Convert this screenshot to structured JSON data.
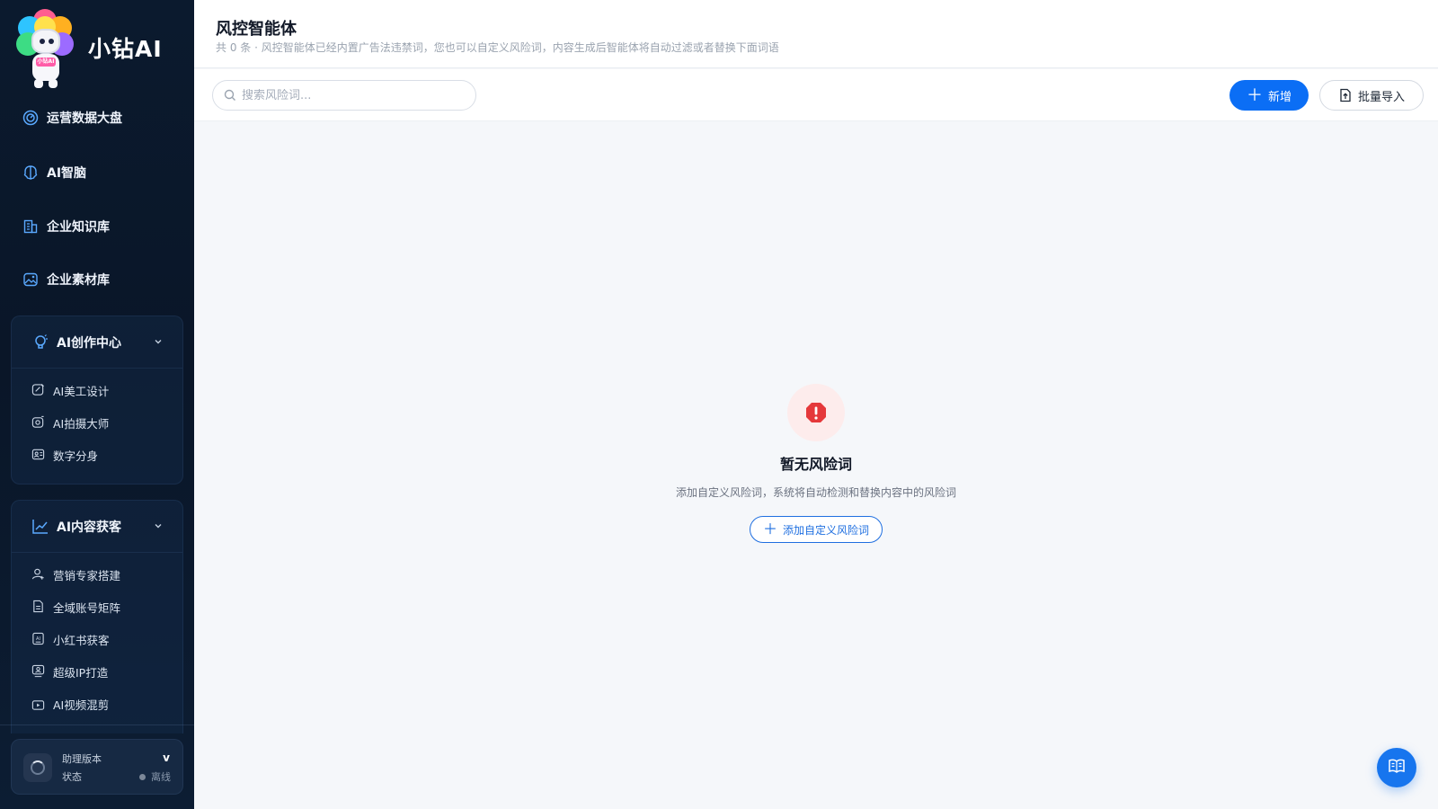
{
  "brand": {
    "name": "小钻AI",
    "mascot_badge": "小钻AI"
  },
  "sidebar": {
    "nav": [
      {
        "label": "运营数据大盘",
        "icon": "dashboard-icon"
      },
      {
        "label": "AI智脑",
        "icon": "brain-icon"
      },
      {
        "label": "企业知识库",
        "icon": "building-icon"
      },
      {
        "label": "企业素材库",
        "icon": "image-icon"
      }
    ],
    "groups": [
      {
        "label": "AI创作中心",
        "icon": "bulb-icon",
        "items": [
          {
            "label": "AI美工设计",
            "icon": "palette-icon"
          },
          {
            "label": "AI拍摄大师",
            "icon": "camera-icon"
          },
          {
            "label": "数字分身",
            "icon": "avatar-card-icon"
          }
        ]
      },
      {
        "label": "AI内容获客",
        "icon": "chart-line-icon",
        "items": [
          {
            "label": "营销专家搭建",
            "icon": "user-add-icon"
          },
          {
            "label": "全域账号矩阵",
            "icon": "document-icon"
          },
          {
            "label": "小红书获客",
            "icon": "ai-doc-icon"
          },
          {
            "label": "超级IP打造",
            "icon": "person-badge-icon"
          },
          {
            "label": "AI视频混剪",
            "icon": "video-icon"
          }
        ]
      }
    ],
    "bottom": {
      "version_label": "助理版本",
      "version_value": "v",
      "status_label": "状态",
      "status_value": "离线"
    }
  },
  "header": {
    "title": "风控智能体",
    "description": "共 0 条 · 风控智能体已经内置广告法违禁词，您也可以自定义风险词，内容生成后智能体将自动过滤或者替换下面词语"
  },
  "toolbar": {
    "search_placeholder": "搜索风险词...",
    "add_label": "新增",
    "import_label": "批量导入"
  },
  "empty_state": {
    "title": "暂无风险词",
    "description": "添加自定义风险词，系统将自动检测和替换内容中的风险词",
    "button_label": "添加自定义风险词"
  },
  "colors": {
    "primary": "#0b6ef5",
    "sidebar_bg": "#0a1628",
    "danger": "#e5383b"
  }
}
